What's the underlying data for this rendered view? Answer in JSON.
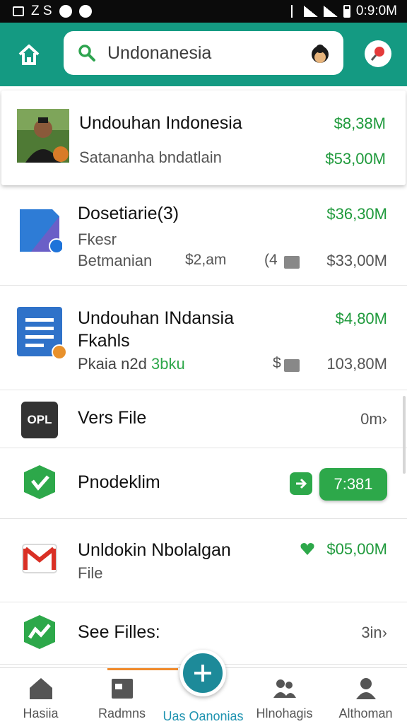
{
  "status_bar": {
    "left_text": "Z S",
    "time": "0:9:0M"
  },
  "search": {
    "value": "Undonanesia"
  },
  "rows": [
    {
      "title": "Undouhan Indonesia",
      "subtitle": "Satananha bndatlain",
      "amount_top": "$8,38M",
      "amount_bottom": "$53,00M"
    },
    {
      "title": "Dosetiarie(3)",
      "subtitle": "Fkesr",
      "detail": "Betmanian",
      "mid_value": "$2,am",
      "mid_count": "(4",
      "amount_top": "$36,30M",
      "amount_bottom": "$33,00M"
    },
    {
      "title": "Undouhan INdansia",
      "subtitle": "Fkahls",
      "detail_a": "Pkaia n2d",
      "detail_b": "3bku",
      "mid_count": "$",
      "amount_top": "$4,80M",
      "amount_bottom": "103,80M",
      "icon_label": ""
    },
    {
      "title": "Vers File",
      "icon_text": "OPL",
      "right": "0m›"
    },
    {
      "title": "Pnodeklim",
      "button_value": "7:381"
    },
    {
      "title": "Unldokin Nbolalgan",
      "subtitle": "File",
      "amount": "$05,00M"
    },
    {
      "title": "See Filles:",
      "right": "3in›"
    }
  ],
  "bottom_nav": [
    {
      "label": "Hasiia",
      "icon": "home-icon"
    },
    {
      "label": "Radmns",
      "icon": "gallery-icon"
    },
    {
      "label": "Uas Oanonias",
      "icon": "add-icon"
    },
    {
      "label": "Hlnohagis",
      "icon": "people-icon"
    },
    {
      "label": "Althoman",
      "icon": "person-icon"
    }
  ],
  "colors": {
    "accent": "#149a82",
    "amount_green": "#1f9a3c",
    "fab": "#1d8a99",
    "active_nav": "#1e93b0"
  }
}
